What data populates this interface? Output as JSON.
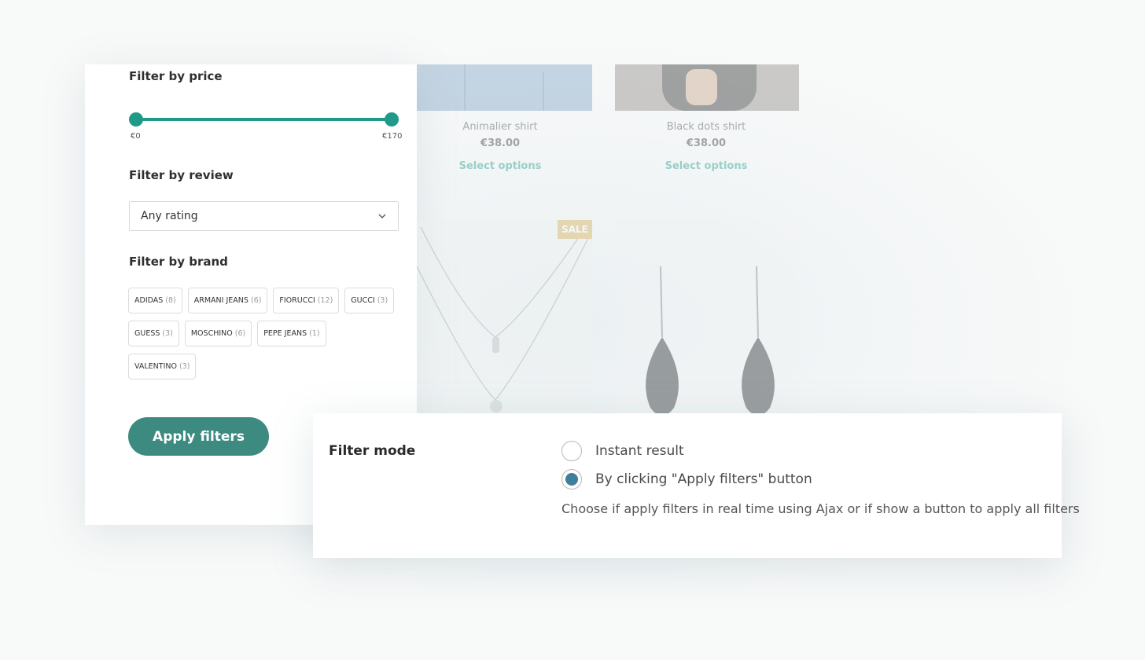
{
  "sidebar": {
    "price_filter": {
      "title": "Filter by price",
      "min_label": "€0",
      "max_label": "€170",
      "range_fraction": [
        0,
        1
      ]
    },
    "review_filter": {
      "title": "Filter by review",
      "selected": "Any rating"
    },
    "brand_filter": {
      "title": "Filter by brand",
      "brands": [
        {
          "name": "ADIDAS",
          "count": "(8)"
        },
        {
          "name": "ARMANI JEANS",
          "count": "(6)"
        },
        {
          "name": "FIORUCCI",
          "count": "(12)"
        },
        {
          "name": "GUCCI",
          "count": "(3)"
        },
        {
          "name": "GUESS",
          "count": "(3)"
        },
        {
          "name": "MOSCHINO",
          "count": "(6)"
        },
        {
          "name": "PEPE JEANS",
          "count": "(1)"
        },
        {
          "name": "VALENTINO",
          "count": "(3)"
        }
      ]
    },
    "apply_label": "Apply filters"
  },
  "products": [
    {
      "name": "Animalier shirt",
      "price": "€38.00",
      "cta": "Select options"
    },
    {
      "name": "Black dots shirt",
      "price": "€38.00",
      "cta": "Select options"
    }
  ],
  "sale_badge": "SALE",
  "filter_mode": {
    "label": "Filter mode",
    "options": [
      {
        "label": "Instant result",
        "selected": false
      },
      {
        "label": "By clicking \"Apply filters\" button",
        "selected": true
      }
    ],
    "description": "Choose if apply filters in real time using Ajax or if show a button to apply all filters"
  },
  "colors": {
    "accent": "#1f9a88",
    "button": "#3d8a80",
    "radio_selected": "#3e7f9c",
    "sale": "#d4b055"
  }
}
